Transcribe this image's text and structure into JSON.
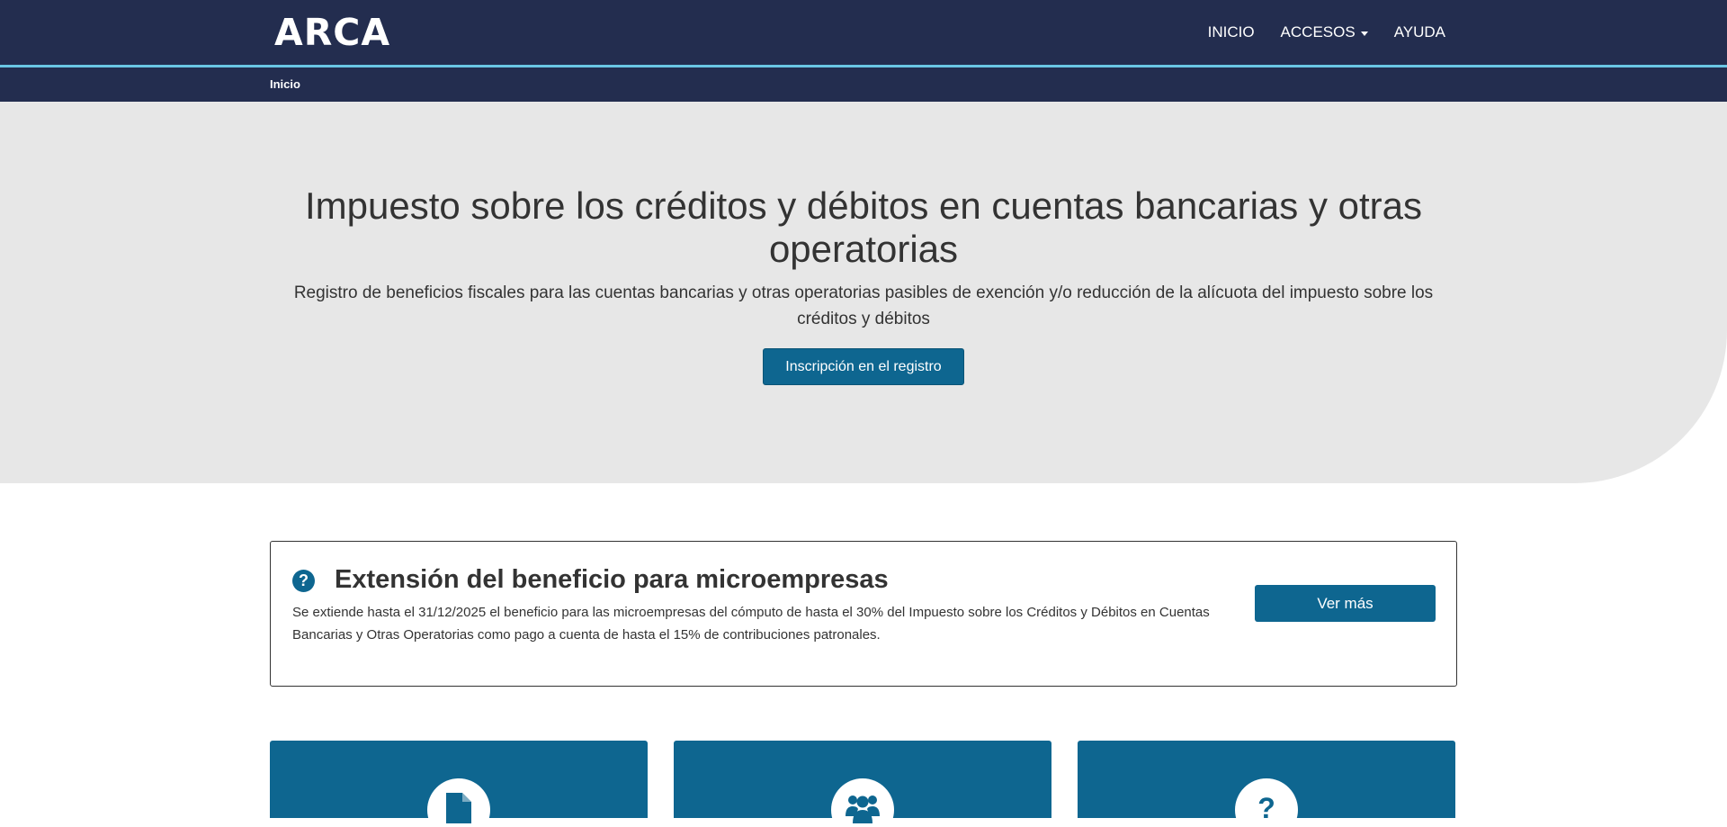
{
  "header": {
    "logo": "ARCA",
    "nav": [
      {
        "label": "INICIO"
      },
      {
        "label": "ACCESOS"
      },
      {
        "label": "AYUDA"
      }
    ],
    "breadcrumb": "Inicio"
  },
  "hero": {
    "title": "Impuesto sobre los créditos y débitos en cuentas bancarias y otras operatorias",
    "subtitle": "Registro de beneficios fiscales para las cuentas bancarias y otras operatorias pasibles de exención y/o reducción de la alícuota del impuesto sobre los créditos y débitos",
    "button_label": "Inscripción en el registro"
  },
  "notice": {
    "icon": "question-circle-icon",
    "title": "Extensión del beneficio para microempresas",
    "text": "Se extiende hasta el 31/12/2025 el beneficio para las microempresas del cómputo de hasta el 30% del Impuesto sobre los Créditos y Débitos en Cuentas Bancarias y Otras Operatorias como pago a cuenta de hasta el 15% de contribuciones patronales.",
    "button_label": "Ver más"
  },
  "cards": [
    {
      "icon": "document-icon"
    },
    {
      "icon": "users-icon"
    },
    {
      "icon": "question-icon",
      "glyph": "?"
    }
  ],
  "colors": {
    "header_bg": "#232d4f",
    "accent_line": "#6ac6e4",
    "primary": "#0e6690",
    "hero_bg": "#e7e7e7"
  }
}
